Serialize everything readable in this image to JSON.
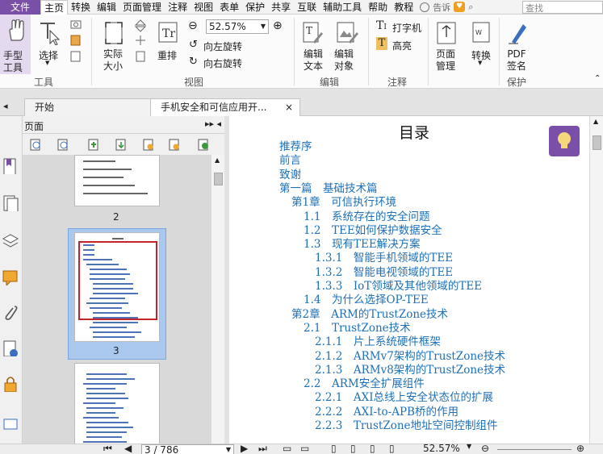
{
  "menubar": {
    "file": "文件",
    "tabs": [
      "主页",
      "转换",
      "编辑",
      "页面管理",
      "注释",
      "视图",
      "表单",
      "保护",
      "共享",
      "互联",
      "辅助工具",
      "帮助",
      "教程"
    ],
    "active_tab": "主页",
    "tell_me": "告诉",
    "search_placeholder": "查找"
  },
  "ribbon": {
    "hand_tool": "手型\n工具",
    "select": "选择",
    "group_tools": "工具",
    "actual_size": "实际\n大小",
    "reflow": "重排",
    "zoom_value": "52.57%",
    "rotate_left": "向左旋转",
    "rotate_right": "向右旋转",
    "group_view": "视图",
    "edit_text": "编辑\n文本",
    "edit_object": "编辑\n对象",
    "group_edit": "编辑",
    "typewriter": "打字机",
    "highlight": "高亮",
    "group_comment": "注释",
    "page_manage": "页面\n管理",
    "convert": "转换",
    "pdf_sign": "PDF\n签名",
    "group_protect": "保护"
  },
  "tabs": {
    "start": "开始",
    "document": "手机安全和可信应用开...",
    "close": "×"
  },
  "panel": {
    "title": "页面",
    "thumbs": [
      "2",
      "3"
    ]
  },
  "document": {
    "title": "目录",
    "toc": [
      {
        "level": 0,
        "text": "推荐序"
      },
      {
        "level": 0,
        "text": "前言"
      },
      {
        "level": 0,
        "text": "致谢"
      },
      {
        "level": 0,
        "text": "第一篇　基础技术篇"
      },
      {
        "level": 1,
        "text": "第1章　可信执行环境"
      },
      {
        "level": 2,
        "text": "1.1　系统存在的安全问题"
      },
      {
        "level": 2,
        "text": "1.2　TEE如何保护数据安全"
      },
      {
        "level": 2,
        "text": "1.3　现有TEE解决方案"
      },
      {
        "level": 3,
        "text": "1.3.1　智能手机领域的TEE"
      },
      {
        "level": 3,
        "text": "1.3.2　智能电视领域的TEE"
      },
      {
        "level": 3,
        "text": "1.3.3　IoT领域及其他领域的TEE"
      },
      {
        "level": 2,
        "text": "1.4　为什么选择OP-TEE"
      },
      {
        "level": 1,
        "text": "第2章　ARM的TrustZone技术"
      },
      {
        "level": 2,
        "text": "2.1　TrustZone技术"
      },
      {
        "level": 3,
        "text": "2.1.1　片上系统硬件框架"
      },
      {
        "level": 3,
        "text": "2.1.2　ARMv7架构的TrustZone技术"
      },
      {
        "level": 3,
        "text": "2.1.3　ARMv8架构的TrustZone技术"
      },
      {
        "level": 2,
        "text": "2.2　ARM安全扩展组件"
      },
      {
        "level": 3,
        "text": "2.2.1　AXI总线上安全状态位的扩展"
      },
      {
        "level": 3,
        "text": "2.2.2　AXI-to-APB桥的作用"
      },
      {
        "level": 3,
        "text": "2.2.3　TrustZone地址空间控制组件"
      }
    ]
  },
  "status": {
    "page_value": "3 / 786",
    "zoom": "52.57%"
  },
  "colors": {
    "accent": "#7a4fa8",
    "link": "#1d70b8",
    "selection": "#aac8ee"
  }
}
